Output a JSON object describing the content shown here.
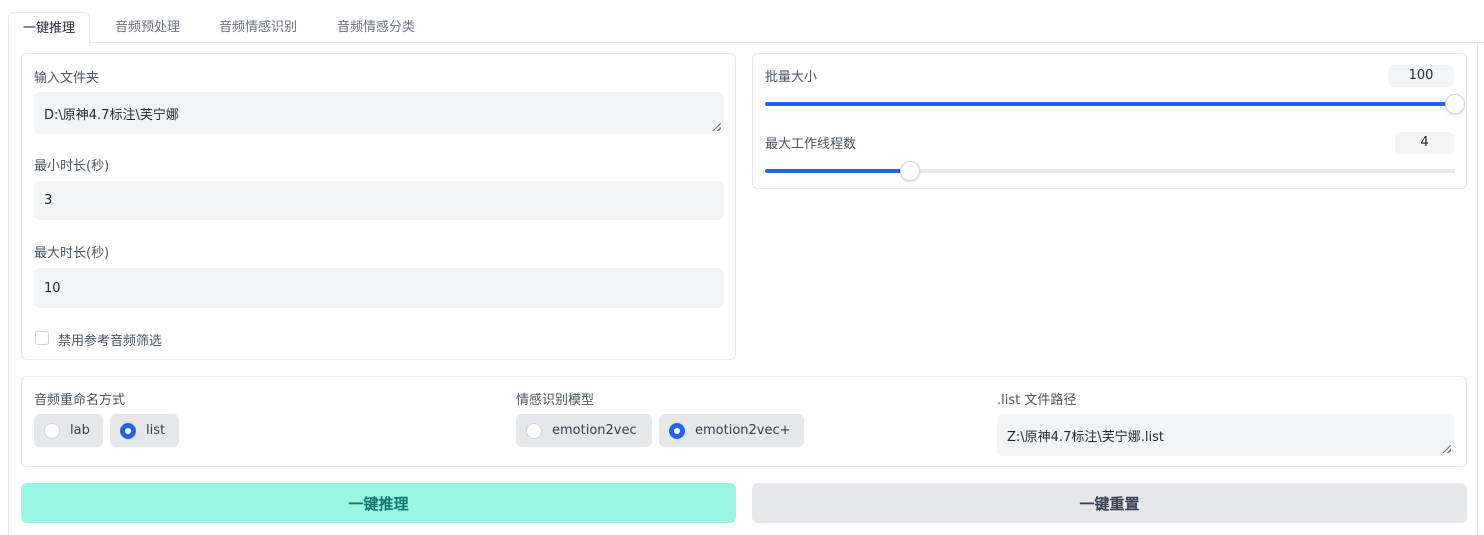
{
  "tabs": [
    "一键推理",
    "音频预处理",
    "音频情感识别",
    "音频情感分类"
  ],
  "left_panel": {
    "input_folder_label": "输入文件夹",
    "input_folder_value": "D:\\原神4.7标注\\芙宁娜",
    "min_duration_label": "最小时长(秒)",
    "min_duration_value": "3",
    "max_duration_label": "最大时长(秒)",
    "max_duration_value": "10",
    "disable_ref_filter_label": "禁用参考音频筛选",
    "disable_ref_filter_checked": false
  },
  "right_panel": {
    "batch_size_label": "批量大小",
    "batch_size_value": "100",
    "batch_size_fraction": 1.0,
    "max_workers_label": "最大工作线程数",
    "max_workers_value": "4",
    "max_workers_fraction": 0.21
  },
  "options_panel": {
    "rename_label": "音频重命名方式",
    "rename_options": [
      "lab",
      "list"
    ],
    "rename_selected": "list",
    "model_label": "情感识别模型",
    "model_options": [
      "emotion2vec",
      "emotion2vec+"
    ],
    "model_selected": "emotion2vec+",
    "list_path_label": ".list 文件路径",
    "list_path_value": "Z:\\原神4.7标注\\芙宁娜.list"
  },
  "buttons": {
    "infer_label": "一键推理",
    "reset_label": "一键重置"
  },
  "colors": {
    "accent": "#2563eb",
    "primary_button_bg": "#99f6e4",
    "primary_button_text": "#0f766e",
    "secondary_button_bg": "#e5e7eb"
  }
}
